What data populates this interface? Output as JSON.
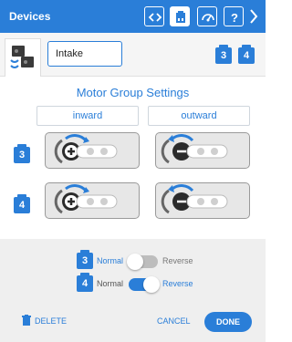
{
  "header": {
    "title": "Devices",
    "icons": [
      "code-icon",
      "device-icon",
      "dashboard-icon",
      "help-icon",
      "chevron-right-icon"
    ]
  },
  "device": {
    "name_value": "Intake",
    "ports": [
      "3",
      "4"
    ]
  },
  "settings": {
    "title": "Motor Group Settings",
    "direction_labels": [
      "inward",
      "outward"
    ],
    "rows": [
      {
        "port": "3"
      },
      {
        "port": "4"
      }
    ]
  },
  "toggles": [
    {
      "port": "3",
      "normal": "Normal",
      "reverse": "Reverse",
      "state": "normal"
    },
    {
      "port": "4",
      "normal": "Normal",
      "reverse": "Reverse",
      "state": "reverse"
    }
  ],
  "footer": {
    "delete_label": "DELETE",
    "cancel_label": "CANCEL",
    "done_label": "DONE"
  },
  "colors": {
    "accent": "#2a7ed8",
    "panel": "#efefef",
    "header": "#2a7ed8"
  }
}
